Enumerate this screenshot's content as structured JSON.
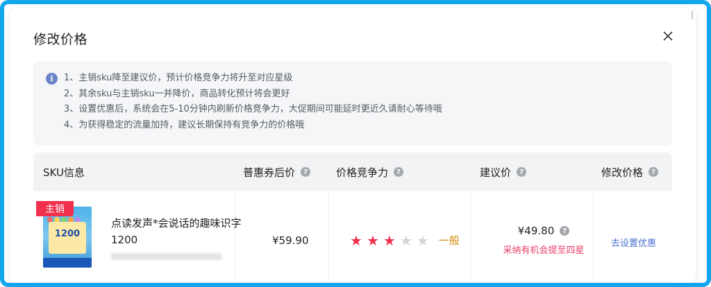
{
  "dialog": {
    "title": "修改价格"
  },
  "notice": {
    "lines": [
      "1、主销sku降至建议价，预计价格竞争力将升至对应星级",
      "2、其余sku与主销sku一并降价，商品转化预计将会更好",
      "3、设置优惠后，系统会在5-10分钟内刷新价格竞争力，大促期间可能延时更近久请耐心等待哦",
      "4、为获得稳定的流量加持，建议长期保持有竞争力的价格哦"
    ]
  },
  "table": {
    "headers": {
      "sku": "SKU信息",
      "coupon_price": "普惠券后价",
      "competitiveness": "价格竞争力",
      "suggested": "建议价",
      "modify": "修改价格"
    },
    "rows": [
      {
        "badge": "主销",
        "product_name": "点读发声*会说话的趣味识字1200",
        "product_image_text": "1200",
        "coupon_price": "¥59.90",
        "stars_filled": 3,
        "stars_total": 5,
        "level_text": "一般",
        "suggested_price": "¥49.80",
        "suggested_tip": "采纳有机会提至四星",
        "action": "去设置优惠"
      }
    ]
  },
  "colors": {
    "frame": "#12a6ec",
    "badge": "#f0304c",
    "star_on": "#f0304c",
    "level": "#d48b0d",
    "tip": "#e8426a",
    "link": "#4a6fd0"
  }
}
